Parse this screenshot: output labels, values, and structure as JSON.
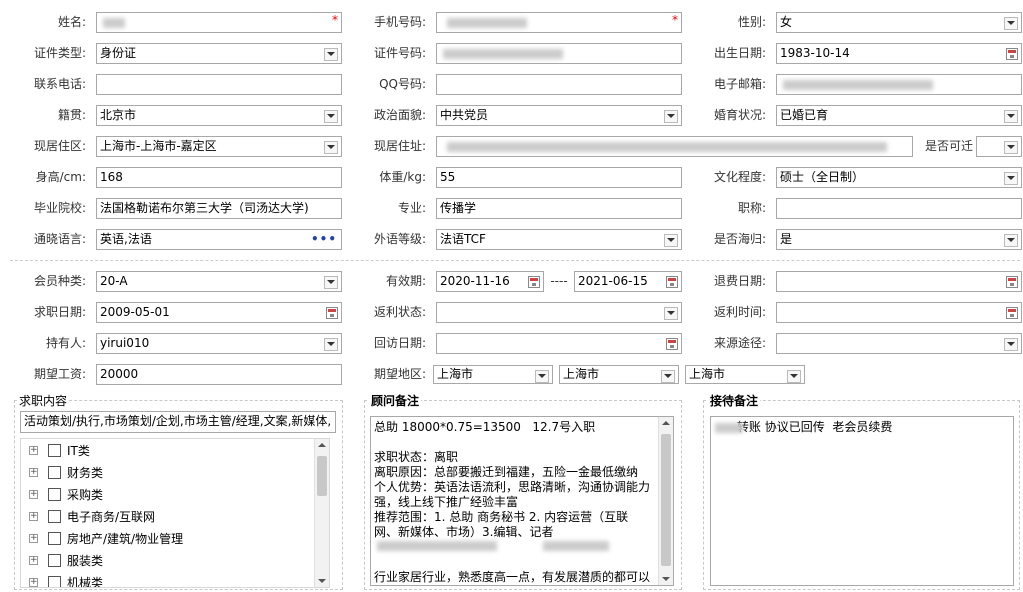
{
  "basic": {
    "name": {
      "label": "姓名:",
      "value": ""
    },
    "phone": {
      "label": "手机号码:",
      "value": ""
    },
    "gender": {
      "label": "性别:",
      "value": "女"
    },
    "id_type": {
      "label": "证件类型:",
      "value": "身份证"
    },
    "id_number": {
      "label": "证件号码:",
      "value": ""
    },
    "birth": {
      "label": "出生日期:",
      "value": "1983-10-14"
    },
    "contact": {
      "label": "联系电话:",
      "value": ""
    },
    "qq": {
      "label": "QQ号码:",
      "value": ""
    },
    "email": {
      "label": "电子邮箱:",
      "value": ""
    },
    "native": {
      "label": "籍贯:",
      "value": "北京市"
    },
    "political": {
      "label": "政治面貌:",
      "value": "中共党员"
    },
    "marital": {
      "label": "婚育状况:",
      "value": "已婚已育"
    },
    "residence_area": {
      "label": "现居住区:",
      "value": "上海市-上海市-嘉定区"
    },
    "address": {
      "label": "现居住址:",
      "value": ""
    },
    "relocate": {
      "label": "是否可迁",
      "value": ""
    },
    "height": {
      "label": "身高/cm:",
      "value": "168"
    },
    "weight": {
      "label": "体重/kg:",
      "value": "55"
    },
    "education": {
      "label": "文化程度:",
      "value": "硕士（全日制）"
    },
    "school": {
      "label": "毕业院校:",
      "value": "法国格勒诺布尔第三大学（司汤达大学)"
    },
    "major": {
      "label": "专业:",
      "value": "传播学"
    },
    "title": {
      "label": "职称:",
      "value": ""
    },
    "languages": {
      "label": "通晓语言:",
      "value": "英语,法语"
    },
    "lang_level": {
      "label": "外语等级:",
      "value": "法语TCF"
    },
    "overseas": {
      "label": "是否海归:",
      "value": "是"
    }
  },
  "member": {
    "type": {
      "label": "会员种类:",
      "value": "20-A"
    },
    "valid": {
      "label": "有效期:",
      "from": "2020-11-16",
      "sep": "----",
      "to": "2021-06-15"
    },
    "refund_date": {
      "label": "退费日期:",
      "value": ""
    },
    "job_date": {
      "label": "求职日期:",
      "value": "2009-05-01"
    },
    "rebate_status": {
      "label": "返利状态:",
      "value": ""
    },
    "rebate_time": {
      "label": "返利时间:",
      "value": ""
    },
    "holder": {
      "label": "持有人:",
      "value": "yirui010"
    },
    "visit_date": {
      "label": "回访日期:",
      "value": ""
    },
    "source": {
      "label": "来源途径:",
      "value": ""
    },
    "salary": {
      "label": "期望工资:",
      "value": "20000"
    },
    "region": {
      "label": "期望地区:",
      "v1": "上海市",
      "v2": "上海市",
      "v3": "上海市"
    }
  },
  "job_panel": {
    "legend": "求职内容",
    "summary": "活动策划/执行,市场策划/企划,市场主管/经理,文案,新媒体,",
    "items": [
      "IT类",
      "财务类",
      "采购类",
      "电子商务/互联网",
      "房地产/建筑/物业管理",
      "服装类",
      "机械类"
    ]
  },
  "advisor_panel": {
    "legend": "顾问备注",
    "text": "总助 18000*0.75=13500   12.7号入职\n\n求职状态：离职\n离职原因：总部要搬迁到福建，五险一金最低缴纳\n个人优势：英语法语流利，思路清晰，沟通协调能力\n强，线上线下推广经验丰富\n推荐范围：1. 总助 商务秘书 2. 内容运营（互联\n网、新媒体、市场）3.编辑、记者\n\n\n行业家居行业，熟悉度高一点，有发展潜质的都可以"
  },
  "reception_panel": {
    "legend": "接待备注",
    "text": "      转账 协议已回传  老会员续费"
  },
  "colors": {
    "required": "#e00000",
    "border": "#a8a8a8"
  }
}
